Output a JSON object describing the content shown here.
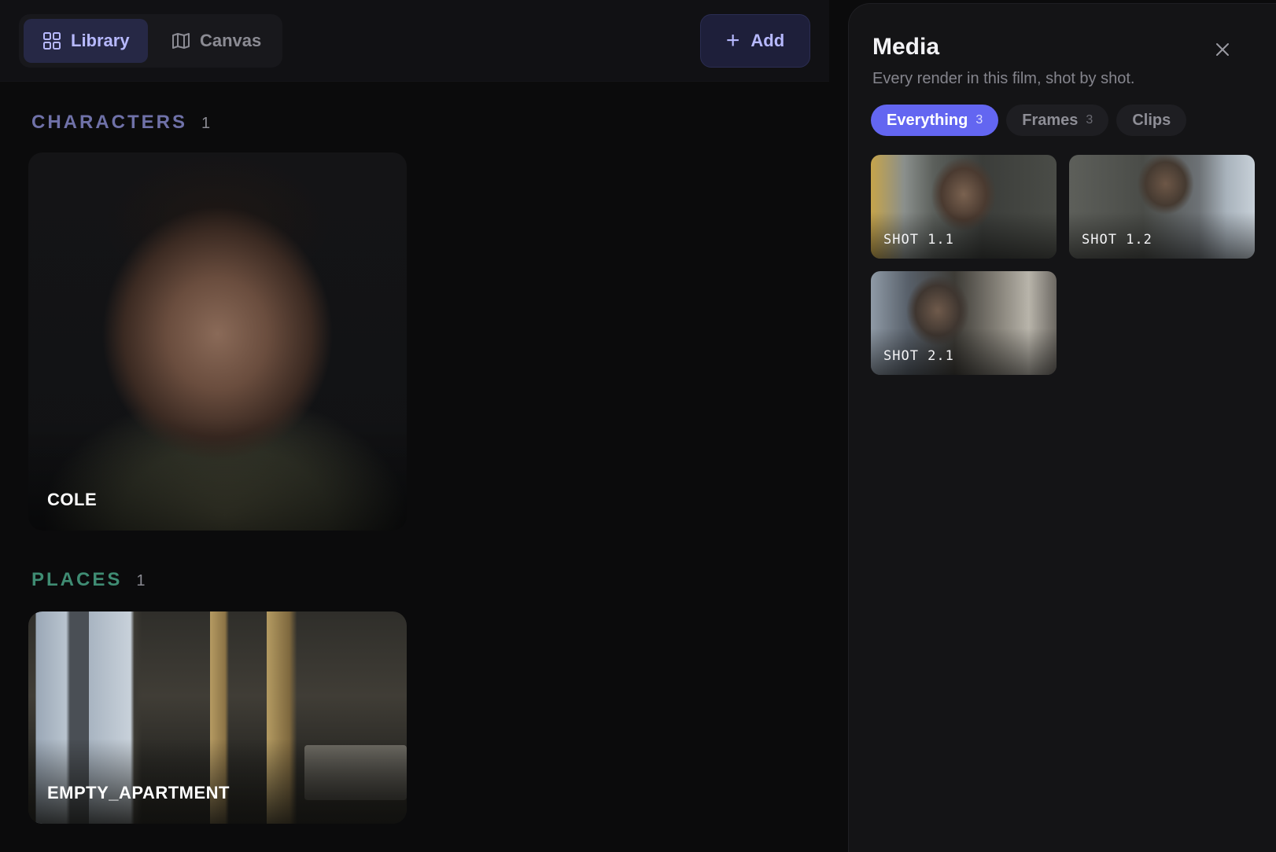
{
  "toolbar": {
    "tabs": [
      {
        "label": "Library",
        "icon": "grid-icon",
        "active": true
      },
      {
        "label": "Canvas",
        "icon": "map-icon",
        "active": false
      }
    ],
    "add_label": "Add"
  },
  "library": {
    "characters": {
      "title": "CHARACTERS",
      "count": "1",
      "color": "#6f71a8",
      "items": [
        {
          "label": "COLE"
        }
      ]
    },
    "places": {
      "title": "PLACES",
      "count": "1",
      "color": "#3f8c73",
      "items": [
        {
          "label": "EMPTY_APARTMENT"
        }
      ]
    }
  },
  "media": {
    "title": "Media",
    "subtitle": "Every render in this film, shot by shot.",
    "filters": [
      {
        "label": "Everything",
        "count": "3",
        "active": true
      },
      {
        "label": "Frames",
        "count": "3",
        "active": false
      },
      {
        "label": "Clips",
        "count": "",
        "active": false
      }
    ],
    "shots": [
      {
        "label": "SHOT 1.1"
      },
      {
        "label": "SHOT 1.2"
      },
      {
        "label": "SHOT 2.1"
      }
    ],
    "accent": "#6366f1"
  }
}
